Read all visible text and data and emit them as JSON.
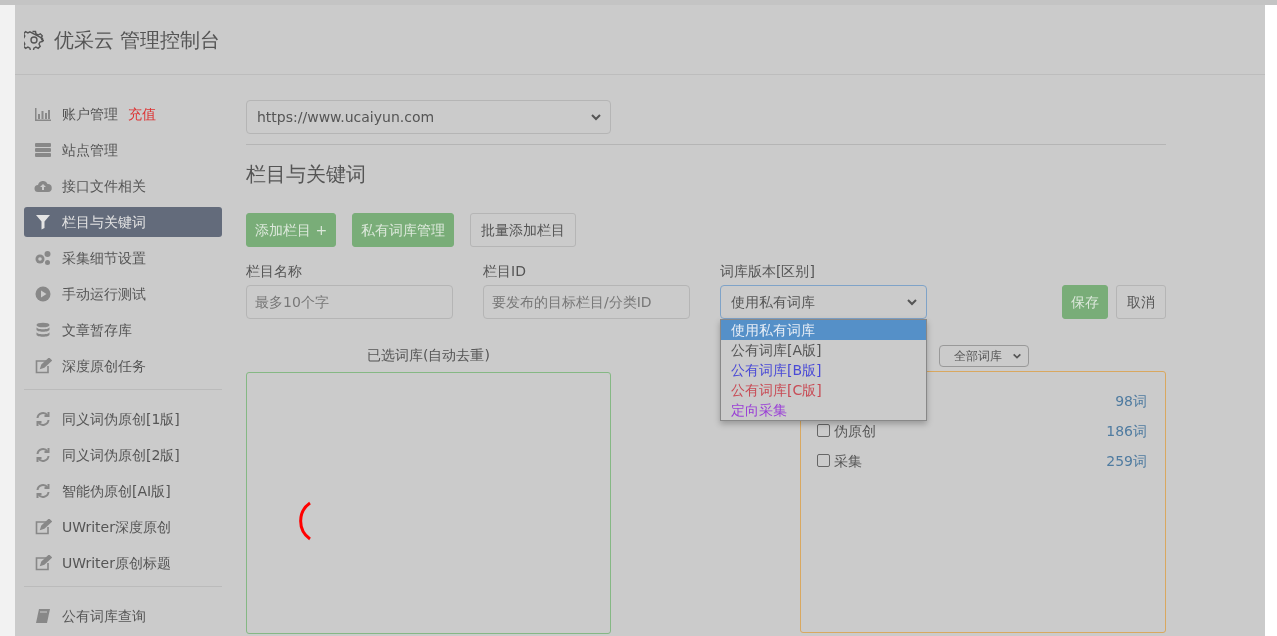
{
  "header": {
    "title": "优采云 管理控制台"
  },
  "sidebar": {
    "groups": [
      [
        {
          "label": "账户管理",
          "badge": "充值",
          "kind": "chart",
          "selected": false
        },
        {
          "label": "站点管理",
          "kind": "server",
          "selected": false
        },
        {
          "label": "接口文件相关",
          "kind": "cloud",
          "selected": false
        },
        {
          "label": "栏目与关键词",
          "kind": "filter",
          "selected": true
        },
        {
          "label": "采集细节设置",
          "kind": "gears",
          "selected": false
        },
        {
          "label": "手动运行测试",
          "kind": "play",
          "selected": false
        },
        {
          "label": "文章暂存库",
          "kind": "database",
          "selected": false
        },
        {
          "label": "深度原创任务",
          "kind": "edit",
          "selected": false
        }
      ],
      [
        {
          "label": "同义词伪原创[1版]",
          "kind": "refresh",
          "selected": false
        },
        {
          "label": "同义词伪原创[2版]",
          "kind": "refresh",
          "selected": false
        },
        {
          "label": "智能伪原创[AI版]",
          "kind": "refresh",
          "selected": false
        },
        {
          "label": "UWriter深度原创",
          "kind": "edit",
          "selected": false
        },
        {
          "label": "UWriter原创标题",
          "kind": "edit",
          "selected": false
        }
      ],
      [
        {
          "label": "公有词库查询",
          "kind": "book",
          "selected": false
        }
      ]
    ]
  },
  "site_select": {
    "value": "https://www.ucaiyun.com"
  },
  "heading": "栏目与关键词",
  "toolbar": [
    {
      "label": "添加栏目 +",
      "kind": "primary"
    },
    {
      "label": "私有词库管理",
      "kind": "primary"
    },
    {
      "label": "批量添加栏目",
      "kind": "outline"
    }
  ],
  "form": {
    "name_field": {
      "label": "栏目名称",
      "placeholder": "最多10个字"
    },
    "id_field": {
      "label": "栏目ID",
      "placeholder": "要发布的目标栏目/分类ID"
    },
    "version_select": {
      "label": "词库版本[区别]",
      "value": "使用私有词库",
      "expanded": true,
      "options": [
        {
          "label": "使用私有词库",
          "selected": true
        },
        {
          "label": "公有词库[A版]",
          "color": "#555555",
          "selected": false
        },
        {
          "label": "公有词库[B版]",
          "color": "#4a4ad6",
          "selected": false
        },
        {
          "label": "公有词库[C版]",
          "color": "#c84b55",
          "selected": false
        },
        {
          "label": "定向采集",
          "color": "#9a3fd6",
          "selected": false
        }
      ]
    },
    "buttons": [
      {
        "label": "保存",
        "kind": "primary"
      },
      {
        "label": "取消",
        "kind": "outline"
      }
    ]
  },
  "selected_panel": {
    "title": "已选词库(自动去重)",
    "loading": true
  },
  "library_panel": {
    "filter": "全部词库",
    "items": [
      {
        "count": "98词"
      },
      {
        "label": "伪原创",
        "checked": false,
        "count": "186词"
      },
      {
        "label": "采集",
        "checked": false,
        "count": "259词"
      }
    ]
  }
}
